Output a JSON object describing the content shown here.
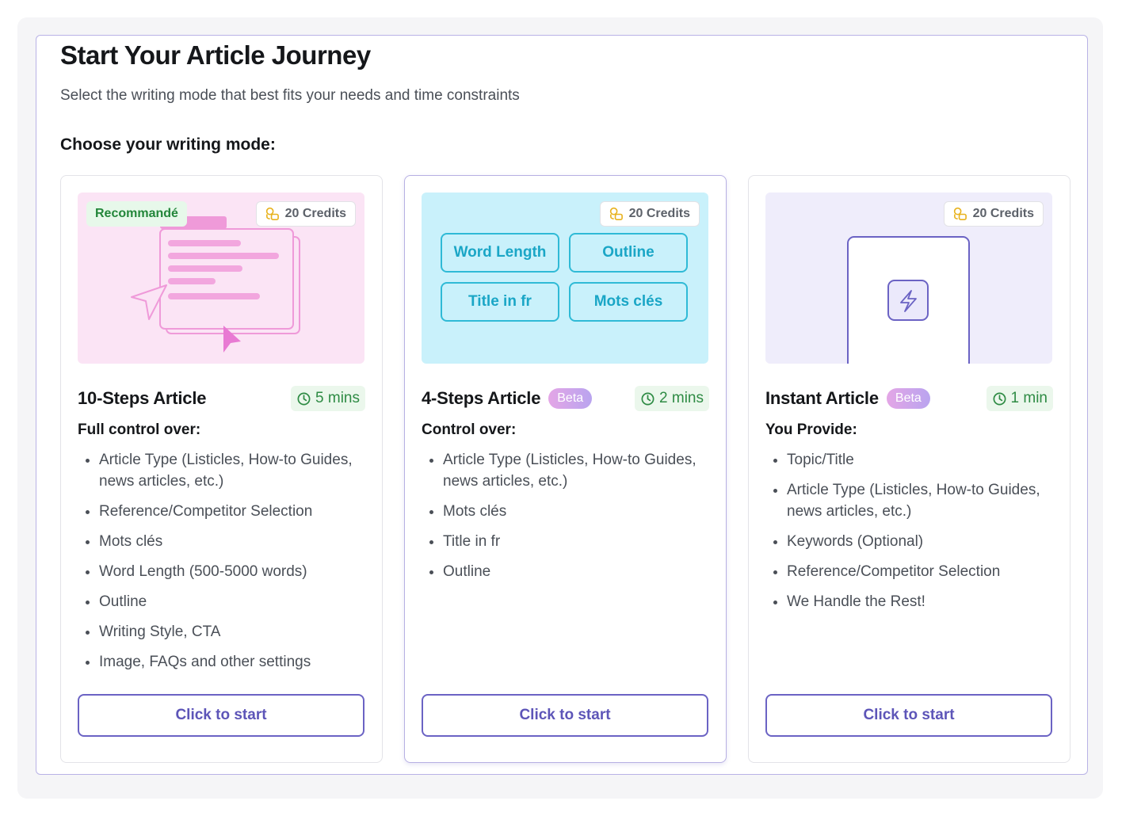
{
  "header": {
    "title": "Start Your Article Journey",
    "subtitle": "Select the writing mode that best fits your needs and time constraints",
    "choose_label": "Choose your writing mode:"
  },
  "colors": {
    "accent": "#6b63c4",
    "green": "#2e8b44",
    "cyan": "#1aa6c6",
    "pink_bg": "#fbe4f5",
    "cyan_bg": "#c9f1fb",
    "lavender_bg": "#efedfb"
  },
  "cards": [
    {
      "title": "10-Steps Article",
      "badge": "",
      "recommended": "Recommandé",
      "credits": "20 Credits",
      "time": "5 mins",
      "control_label": "Full control over:",
      "features": [
        "Article Type (Listicles, How-to Guides, news articles, etc.)",
        "Reference/Competitor Selection",
        "Mots clés",
        "Word Length (500-5000 words)",
        "Outline",
        "Writing Style, CTA",
        "Image, FAQs and other settings"
      ],
      "button": "Click to start"
    },
    {
      "title": "4-Steps Article",
      "badge": "Beta",
      "credits": "20 Credits",
      "time": "2 mins",
      "chips": [
        "Word Length",
        "Outline",
        "Title in fr",
        "Mots clés"
      ],
      "control_label": "Control over:",
      "features": [
        "Article Type (Listicles, How-to Guides, news articles, etc.)",
        "Mots clés",
        "Title in fr",
        "Outline"
      ],
      "button": "Click to start"
    },
    {
      "title": "Instant Article",
      "badge": "Beta",
      "credits": "20 Credits",
      "time": "1 min",
      "control_label": "You Provide:",
      "features": [
        "Topic/Title",
        "Article Type (Listicles, How-to Guides, news articles, etc.)",
        "Keywords (Optional)",
        "Reference/Competitor Selection",
        "We Handle the Rest!"
      ],
      "button": "Click to start"
    }
  ]
}
